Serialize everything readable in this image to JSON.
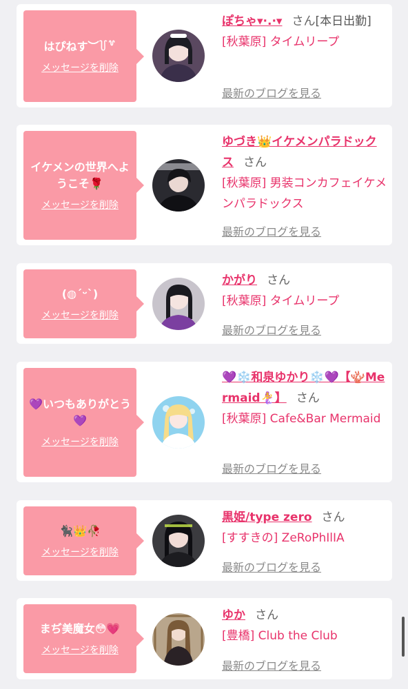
{
  "delete_label": "メッセージを削除",
  "blog_label": "最新のブログを見る",
  "honorific": "さん",
  "colors": {
    "accent": "#e8336b",
    "bubble": "#fa9aa6",
    "background": "#f0f0f3"
  },
  "items": [
    {
      "message": "はぴねす︶꒦꒷",
      "name": "ぽちゃ▾·.·▾",
      "name_suffix": "[本日出勤]",
      "place": "[秋葉原] タイムリープ",
      "avatar_icon": "avatar-icon"
    },
    {
      "message": "イケメンの世界へようこそ🌹",
      "name": "ゆづき👑イケメンパラドックス",
      "name_suffix": "",
      "place": "[秋葉原] 男装コンカフェイケメンパラドックス",
      "avatar_icon": "avatar-icon"
    },
    {
      "message": "(◍ˊᵕˋ)",
      "name": "かがり",
      "name_suffix": "",
      "place": "[秋葉原] タイムリープ",
      "avatar_icon": "avatar-icon"
    },
    {
      "message": "💜いつもありがとう💜",
      "name": "💜❄️和泉ゆかり❄️💜【🪸Mermaid🧜‍♀️】",
      "name_suffix": "",
      "place": "[秋葉原] Cafe&Bar Mermaid",
      "avatar_icon": "avatar-icon"
    },
    {
      "message": "🐈‍⬛👑🥀",
      "name": "黒姫/type zero",
      "name_suffix": "",
      "place": "[すすきの] ZeRoPhIlIA",
      "avatar_icon": "avatar-icon"
    },
    {
      "message": "まぢ美魔女😳💗",
      "name": "ゆか",
      "name_suffix": "",
      "place": "[豊橋] Club the Club",
      "avatar_icon": "avatar-icon"
    }
  ]
}
